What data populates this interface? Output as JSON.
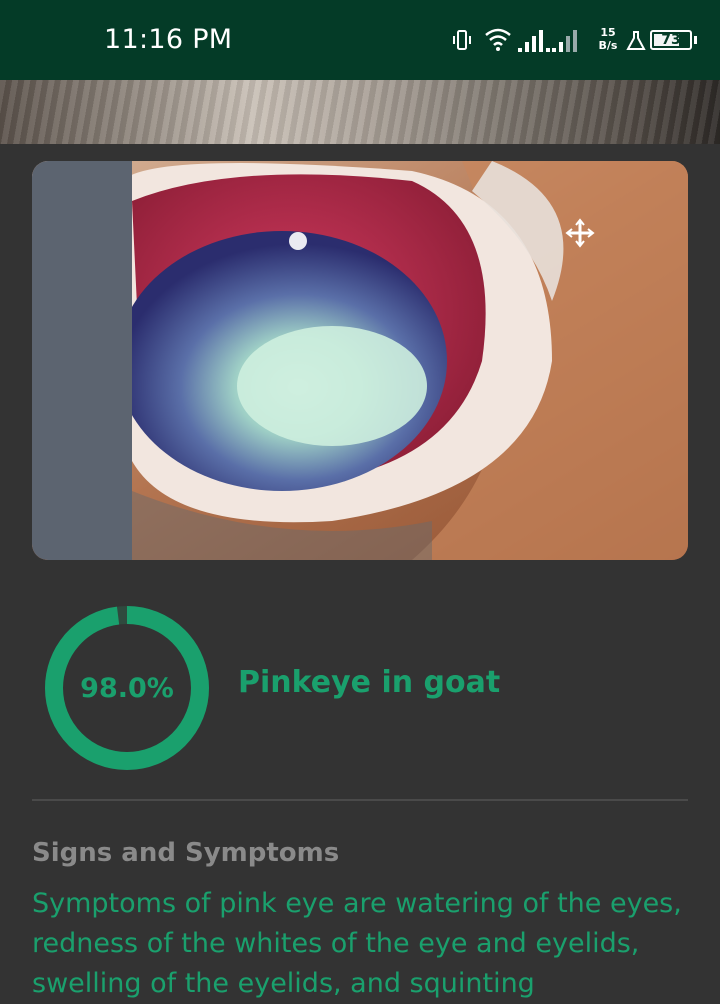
{
  "status_bar": {
    "time": "11:16 PM",
    "net_speed_value": "15",
    "net_speed_unit": "B/s",
    "battery_level": "73",
    "icons": [
      "vibrate-icon",
      "wifi-icon",
      "signal-icon",
      "signal-icon-2",
      "flask-icon",
      "battery-icon"
    ]
  },
  "result": {
    "confidence_text": "98.0%",
    "confidence_value": 0.98,
    "disease_name": "Pinkeye in goat",
    "accent_color": "#1aa06d"
  },
  "details": {
    "section_title": "Signs and Symptoms",
    "symptoms_text": "Symptoms of pink eye are watering of the eyes, redness of the whites of the eye and eyelids, swelling of the eyelids, and squinting"
  },
  "image": {
    "subject": "close-up of infected goat eye"
  }
}
